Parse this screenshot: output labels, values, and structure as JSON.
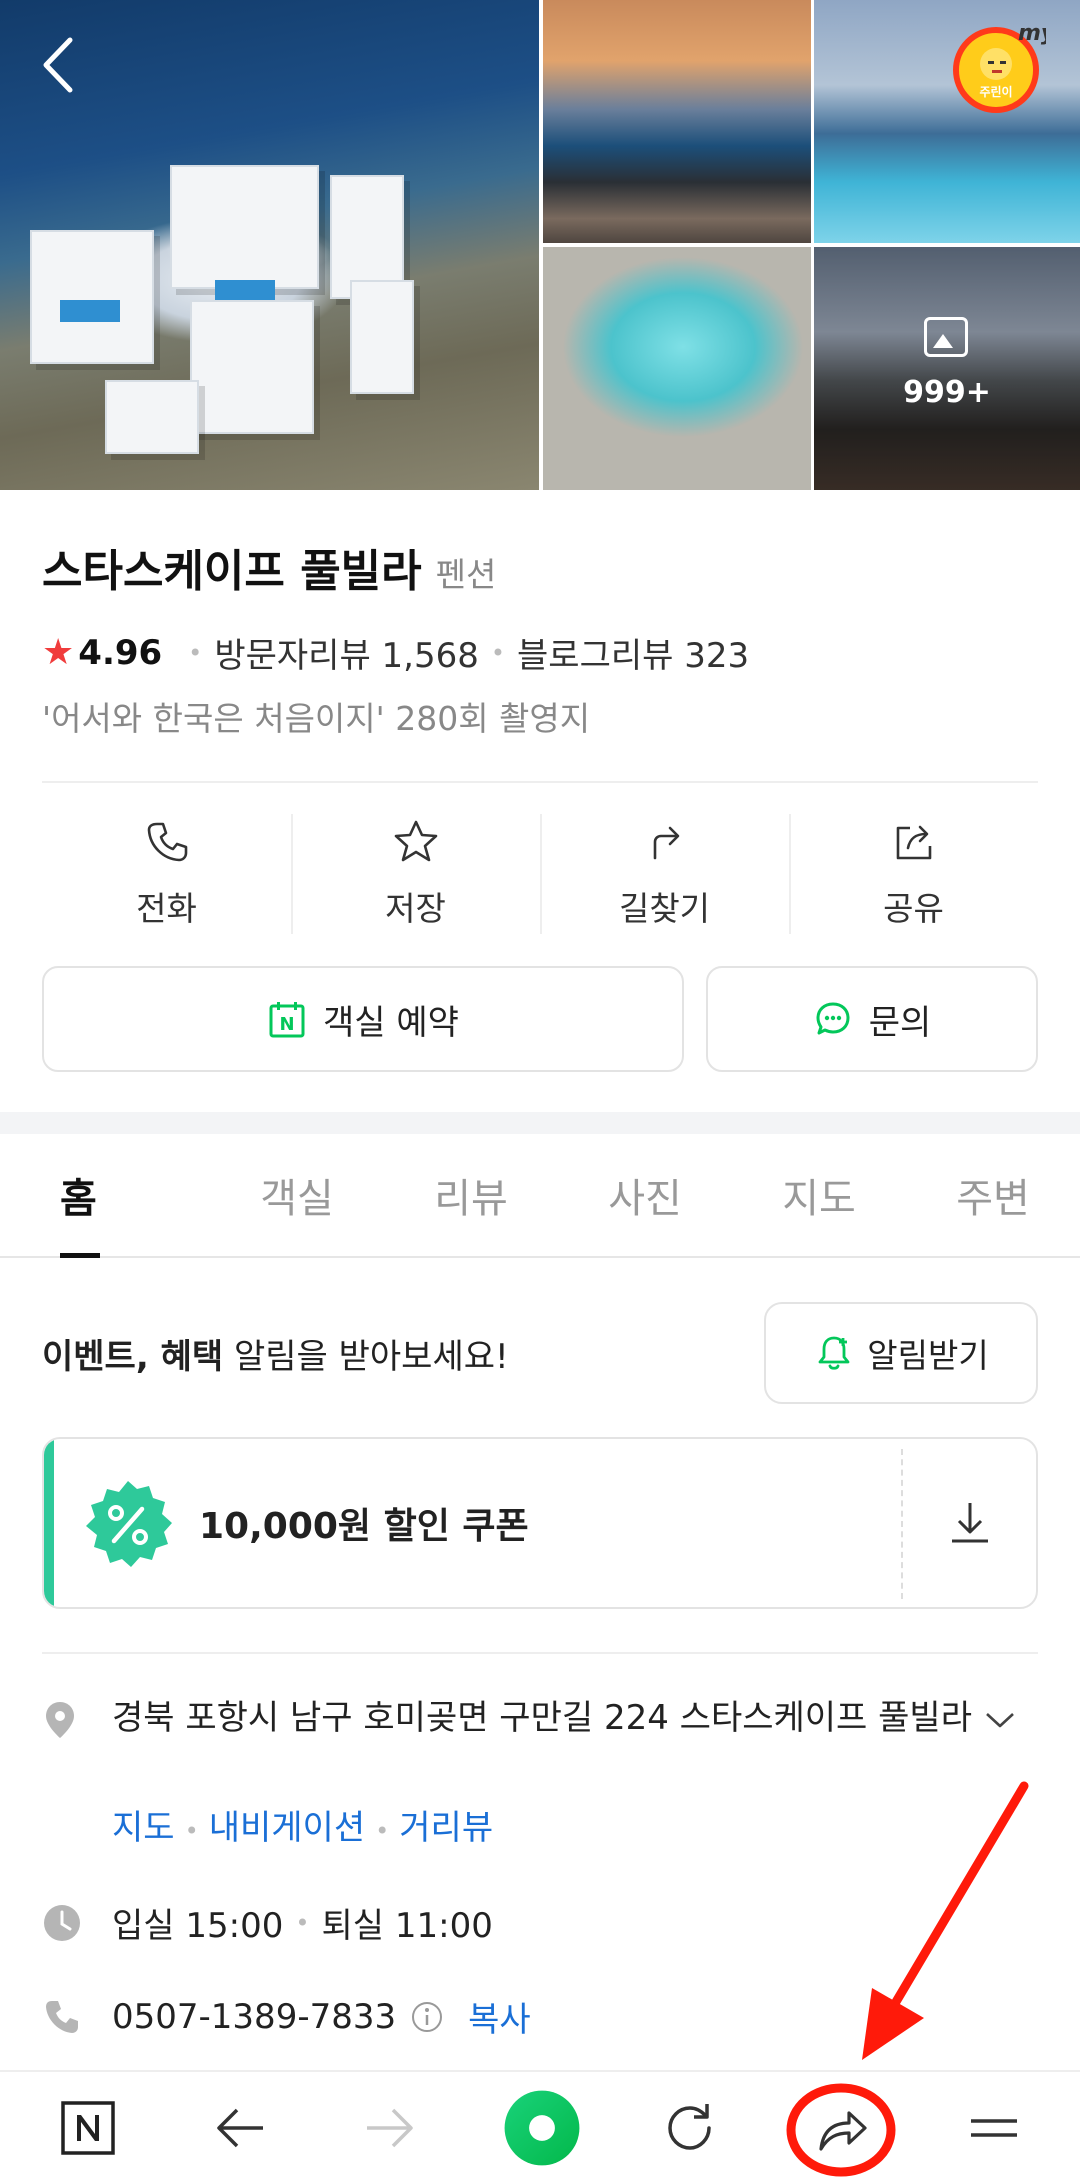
{
  "place": {
    "name": "스타스케이프 풀빌라",
    "category": "펜션",
    "rating": "4.96",
    "visitor_reviews": "방문자리뷰 1,568",
    "blog_reviews": "블로그리뷰 323",
    "subtitle": "'어서와 한국은 처음이지' 280회 촬영지"
  },
  "gallery": {
    "more_count": "999+",
    "badge_text": "my",
    "badge_sub": "주린이"
  },
  "actions": [
    {
      "label": "전화",
      "icon": "phone-icon"
    },
    {
      "label": "저장",
      "icon": "star-icon"
    },
    {
      "label": "길찾기",
      "icon": "directions-icon"
    },
    {
      "label": "공유",
      "icon": "share-icon"
    }
  ],
  "buttons": {
    "reserve": "객실 예약",
    "inquiry": "문의"
  },
  "tabs": [
    "홈",
    "객실",
    "리뷰",
    "사진",
    "지도",
    "주변"
  ],
  "notice": {
    "bold": "이벤트, 혜택",
    "rest": " 알림을 받아보세요!",
    "button": "알림받기"
  },
  "coupon": {
    "text": "10,000원 할인 쿠폰"
  },
  "details": {
    "address": "경북 포항시 남구 호미곶면 구만길 224 스타스케이프 풀빌라",
    "links": [
      "지도",
      "내비게이션",
      "거리뷰"
    ],
    "hours": "입실 15:00",
    "hours2": "퇴실 11:00",
    "phone": "0507-1389-7833",
    "copy": "복사"
  },
  "colors": {
    "accent_green": "#03c75a",
    "link_blue": "#1a6fd6",
    "star_red": "#f03c3c",
    "annotation_red": "#ff1a0a"
  }
}
